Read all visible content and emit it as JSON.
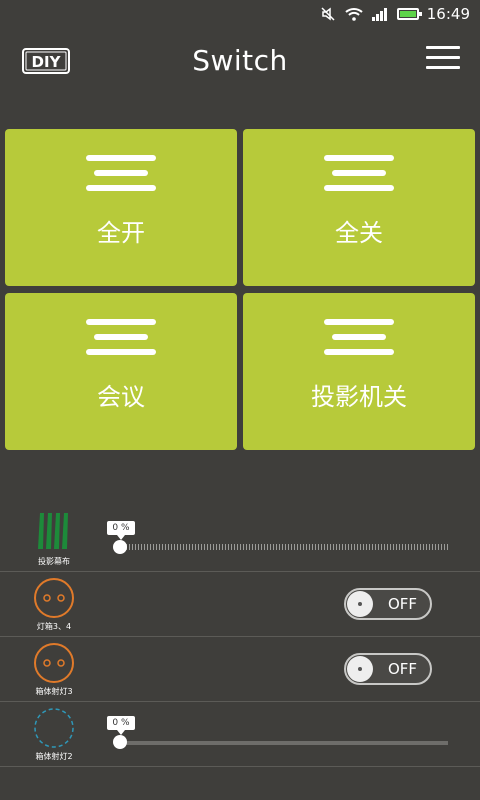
{
  "status_bar": {
    "time": "16:49",
    "icons": [
      "mute-icon",
      "wifi-icon",
      "signal-icon",
      "battery-icon"
    ],
    "battery_color": "#5fd44a"
  },
  "header": {
    "logo_text": "DIY",
    "title": "Switch",
    "menu_icon": "hamburger-menu-icon"
  },
  "tiles": [
    {
      "label": "全开"
    },
    {
      "label": "全关"
    },
    {
      "label": "会议"
    },
    {
      "label": "投影机关"
    }
  ],
  "tile_color": "#b7ca3a",
  "devices": [
    {
      "name": "投影幕布",
      "control": "slider",
      "value_label": "0 %",
      "value": 0,
      "icon": "projector-screen-icon"
    },
    {
      "name": "灯箱3、4",
      "control": "toggle",
      "state_label": "OFF",
      "icon": "socket-icon"
    },
    {
      "name": "箱体射灯3",
      "control": "toggle",
      "state_label": "OFF",
      "icon": "socket-icon"
    },
    {
      "name": "箱体射灯2",
      "control": "slider",
      "value_label": "0 %",
      "value": 0,
      "icon": "dimmer-ring-icon"
    }
  ]
}
